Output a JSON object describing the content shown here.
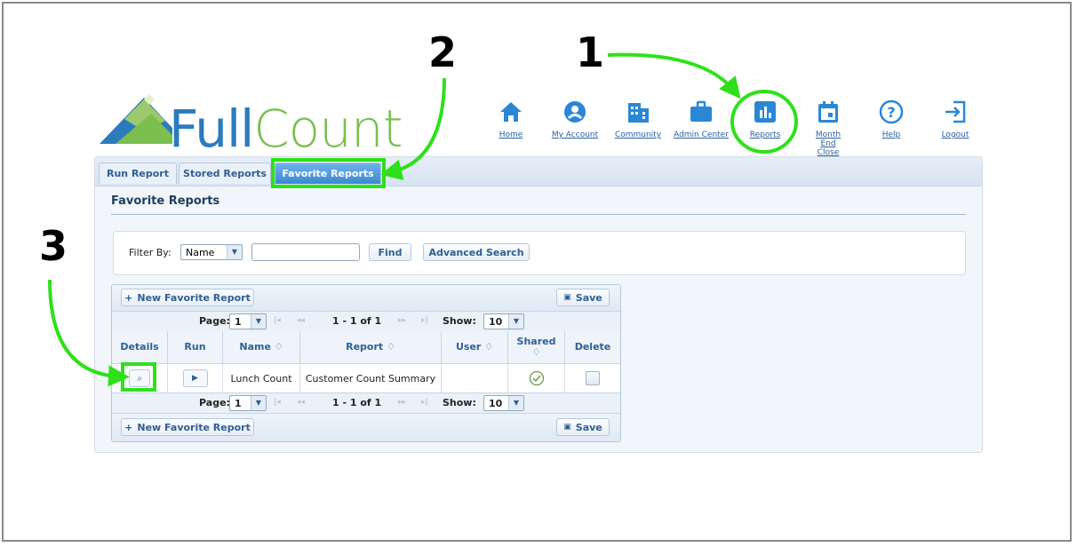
{
  "logo": {
    "part1": "Full",
    "part2": "Count"
  },
  "nav": [
    {
      "label": "Home",
      "icon": "home-icon"
    },
    {
      "label": "My Account",
      "icon": "account-icon"
    },
    {
      "label": "Community",
      "icon": "community-icon"
    },
    {
      "label": "Admin Center",
      "icon": "briefcase-icon"
    },
    {
      "label": "Reports",
      "icon": "chart-icon"
    },
    {
      "label": "Month End Close",
      "icon": "calendar-icon"
    },
    {
      "label": "Help",
      "icon": "help-icon"
    },
    {
      "label": "Logout",
      "icon": "logout-icon"
    }
  ],
  "tabs": [
    {
      "label": "Run Report"
    },
    {
      "label": "Stored Reports"
    },
    {
      "label": "Favorite Reports",
      "active": true
    }
  ],
  "section_title": "Favorite Reports",
  "filter": {
    "label": "Filter By:",
    "selected": "Name",
    "find_label": "Find",
    "advanced_label": "Advanced Search"
  },
  "grid": {
    "new_label": "New Favorite Report",
    "save_label": "Save",
    "page_label": "Page:",
    "page_value": "1",
    "range": "1 - 1 of 1",
    "show_label": "Show:",
    "show_value": "10",
    "columns": [
      "Details",
      "Run",
      "Name ♢",
      "Report ♢",
      "User ♢",
      "Shared ♢",
      "Delete"
    ],
    "rows": [
      {
        "name": "Lunch Count",
        "report": "Customer Count Summary",
        "user": "",
        "shared": true,
        "delete": false
      }
    ]
  },
  "annotations": [
    "1",
    "2",
    "3"
  ],
  "colors": {
    "accent": "#3a89d2",
    "highlight": "#2ee01a",
    "brand_blue": "#2c7bbd",
    "brand_green": "#7bbf4e"
  }
}
